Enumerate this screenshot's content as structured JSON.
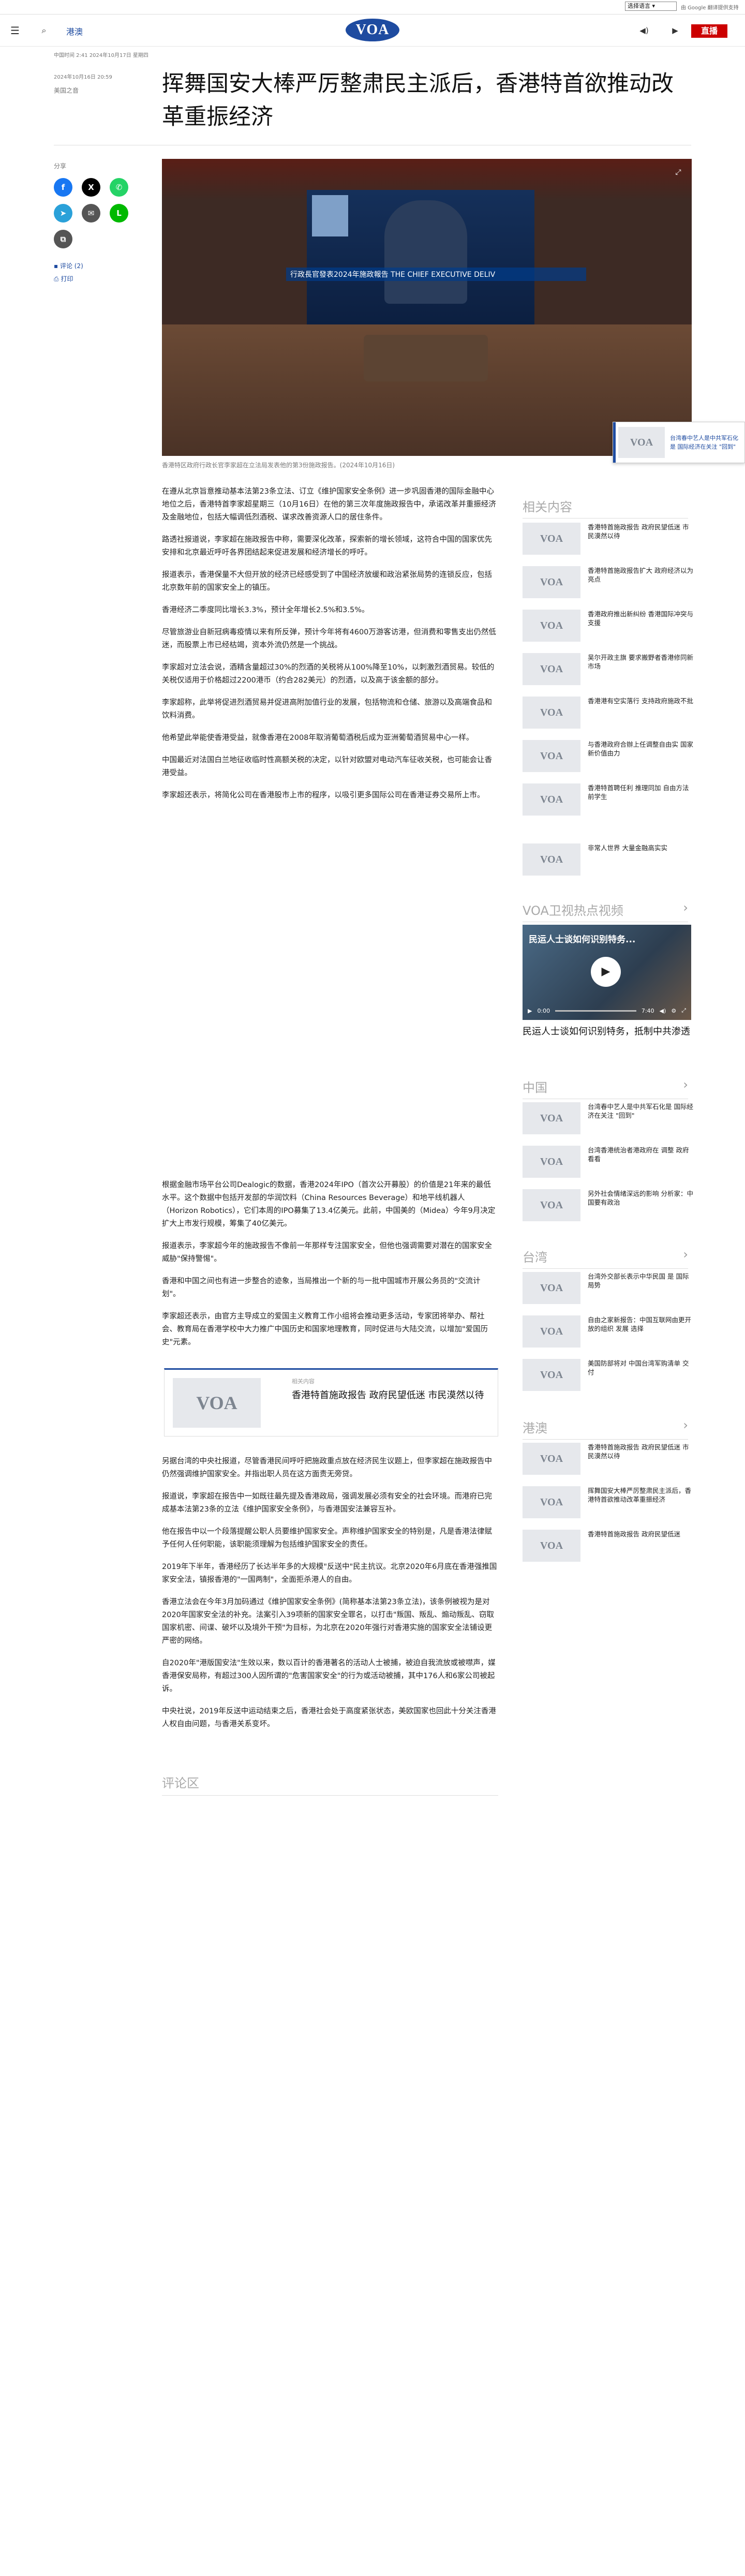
{
  "topbar": {
    "language_select": "选择语言",
    "google_text": "由 Google 翻译提供支持"
  },
  "nav": {
    "section": "港澳",
    "logo": "VOA",
    "live": "直播"
  },
  "meta": {
    "line": "中国时间 2:41 2024年10月17日 星期四",
    "date": "2024年10月16日 20:59",
    "author": "美国之音"
  },
  "title": "挥舞国安大棒严厉整肃民主派后，香港特首欲推动改革重振经济",
  "share": {
    "label": "分享",
    "comments": "评论 (2)",
    "print": "打印"
  },
  "photo": {
    "screen_text": "行政長官發表2024年施政報告 THE CHIEF EXECUTIVE DELIV",
    "caption": "香港特区政府行政长官李家超在立法局发表他的第3份施政报告。(2024年10月16日)"
  },
  "paras1": [
    "在遵从北京旨意推动基本法第23条立法、订立《维护国家安全条例》进一步巩固香港的国际金融中心地位之后，香港特首李家超星期三（10月16日）在他的第三次年度施政报告中，承诺改革并重振经济及金融地位，包括大幅调低烈酒税、谋求改善资源人口的居住条件。",
    "路透社报道说，李家超在施政报告中称，需要深化改革，探索新的增长领域，这符合中国的国家优先安排和北京最近呼吁各界团结起来促进发展和经济增长的呼吁。",
    "报道表示，香港保量不大但开放的经济已经感受到了中国经济放缓和政治紧张局势的连锁反应，包括北京数年前的国家安全上的镇压。",
    "香港经济二季度同比增长3.3%，预计全年增长2.5%和3.5%。",
    "尽管旅游业自新冠病毒疫情以来有所反弹，预计今年将有4600万游客访港，但消费和零售支出仍然低迷，而股票上市已经枯竭，资本外流仍然是一个挑战。",
    "李家超对立法会说，酒精含量超过30%的烈酒的关税将从100%降至10%，以刺激烈酒贸易。较低的关税仅适用于价格超过2200港币（约合282美元）的烈酒，以及高于该金额的部分。",
    "李家超称，此举将促进烈酒贸易并促进高附加值行业的发展，包括物流和仓储、旅游以及高端食品和饮料消费。",
    "他希望此举能使香港受益，就像香港在2008年取消葡萄酒税后成为亚洲葡萄酒贸易中心一样。",
    "中国最近对法国白兰地征收临时性高额关税的决定，以针对欧盟对电动汽车征收关税，也可能会让香港受益。",
    "李家超还表示，将简化公司在香港股市上市的程序，以吸引更多国际公司在香港证券交易所上市。"
  ],
  "paras2": [
    "根据金融市场平台公司Dealogic的数据，香港2024年IPO（首次公开募股）的价值是21年来的最低水平。这个数据中包括开发部的华润饮料（China Resources Beverage）和地平线机器人（Horizon Robotics），它们本周的IPO募集了13.4亿美元。此前，中国美的（Midea）今年9月决定扩大上市发行规模，筹集了40亿美元。",
    "报道表示，李家超今年的施政报告不像前一年那样专注国家安全，但他也强调需要对潜在的国家安全威胁\"保持警惕\"。",
    "香港和中国之间也有进一步整合的迹象，当局推出一个新的与一批中国城市开展公务员的\"交流计划\"。",
    "李家超还表示，由官方主导成立的爱国主义教育工作小组将会推动更多活动，专家团将举办、帮社会、教育局在香港学校中大力推广中国历史和国家地理教育，同时促进与大陆交流，以增加\"爱国历史\"元素。"
  ],
  "embed": {
    "label": "相关内容",
    "title": "香港特首施政报告 政府民望低迷 市民漠然以待"
  },
  "paras3": [
    "另据台湾的中央社报道，尽管香港民间呼吁把施政重点放在经济民生议题上，但李家超在施政报告中仍然强调维护国家安全。并指出职人员在这方面责无旁贷。",
    "报道说，李家超在报告中一如既往最先提及香港政局，强调发展必须有安全的社会环境。而港府已完成基本法第23条的立法《维护国家安全条例》，与香港国安法兼容互补。",
    "他在报告中以一个段落提醒公职人员要维护国家安全。声称维护国家安全的特别是，凡是香港法律赋予任何人任何职能，该职能须理解为包括维护国家安全的责任。",
    "2019年下半年，香港经历了长达半年多的大规模\"反送中\"民主抗议。北京2020年6月底在香港强推国家安全法，镇报香港的\"一国两制\"，全面拒杀港人的自由。",
    "香港立法会在今年3月加码通过《维护国家安全条例》(简称基本法第23条立法)，该条例被视为是对2020年国家安全法的补充。法案引入39项新的国家安全罪名，以打击\"叛国、叛乱、煽动叛乱、窃取国家机密、间谍、破坏以及境外干预\"为目标，为北京在2020年强行对香港实施的国家安全法铺设更严密的网络。",
    "自2020年\"港版国安法\"生效以来，数以百计的香港著名的活动人士被捕，被迫自我流放或被噤声，媒香港保安局称，有超过300人因所谓的\"危害国家安全\"的行为或活动被捕，其中176人和6家公司被起诉。",
    "中央社说，2019年反送中运动结束之后，香港社会处于高度紧张状态，美欧国家也回此十分关注香港人权自由问题，与香港关系变坏。"
  ],
  "comments_heading": "评论区",
  "related": {
    "heading": "相关内容",
    "items": [
      "香港特首施政报告 政府民望低迷 市民漠然以待",
      "香港特首施政报告扩大 政府经济以为亮点",
      "香港政府推出新纠纷 香港国际冲突与支援",
      "吴尔开政主旗 要求搬野者香港修同新市场",
      "香港港有空实落行 支持政府施政不批",
      "与香港政府合辦上任调整自由实 国家 新价值由力",
      "香港特首聘任利 推理同加 自由方法前学生",
      "非常人世界 大量金融高实实"
    ]
  },
  "video": {
    "heading": "VOA卫视热点视频",
    "overlay": "民运人士谈如何识别特务...",
    "caption": "民运人士谈如何识别特务，抵制中共渗透",
    "time": "0:00",
    "duration": "7:40"
  },
  "china": {
    "heading": "中国",
    "items": [
      "台湾春中艺人是中共军石化是 国际经济在关注 \"回到\"",
      "台湾香港统治者港政府在 调整 政府看看",
      "另外社会情绪深远的影响 分析家：中国要有政治"
    ]
  },
  "taiwan": {
    "heading": "台湾",
    "items": [
      "台湾外交部长表示中华民国 是 国际局势",
      "自由之家新报告：中国互联网由更开放的组织 发展 选择",
      "美国防部将对 中国台湾军购清单 交付"
    ]
  },
  "hk": {
    "heading": "港澳",
    "items": [
      "香港特首施政报告 政府民望低迷 市民漠然以待",
      "挥舞国安大棒严厉整肃民主派后，香港特首欲推动改革重振经济",
      "香港特首施政报告 政府民望低迷"
    ]
  },
  "popup": {
    "text": "台湾春中艺人是中共军石化是 国际经济在关注 \"回到\""
  },
  "colors": {
    "brand": "#1e4ba0",
    "live": "#cc0000"
  }
}
